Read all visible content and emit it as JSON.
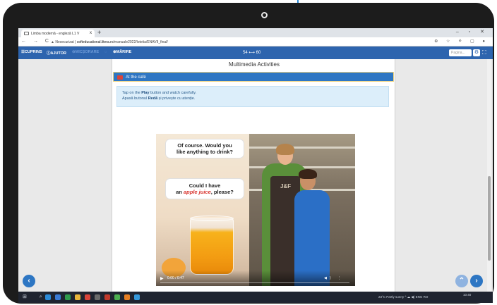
{
  "browser": {
    "tab_title": "Limba modernă - engleză L1 V",
    "new_tab": "+",
    "tab_close": "x",
    "window_controls": "‒ ▫ ✕",
    "nav_buttons": "← → C",
    "security_label": "Nesecurizat",
    "url_domain": "softeducational.litera.ro",
    "url_path": "/manuale2022/lotetia/ENAVII_final/",
    "extension_icons": "⊕ ☆ ⚘ ▢ ●"
  },
  "toolbar": {
    "cuprins": "CUPRINS",
    "ajutor": "AJUTOR",
    "micsorare": "MICȘORARE",
    "marire": "MĂRIRE",
    "pages": "54 ⟷ 60",
    "page_placeholder": "Pagina..."
  },
  "panel": {
    "title": "Multimedia Activities",
    "section": "At the café",
    "instruction_en_pre": "Tap on the ",
    "instruction_en_bold": "Play",
    "instruction_en_post": " button and watch carefully.",
    "instruction_ro_pre": "Apasă butonul ",
    "instruction_ro_bold": "Redă",
    "instruction_ro_post": " și privește cu atenție."
  },
  "video": {
    "bubble1_line1": "Of course. Would you",
    "bubble1_line2": "like anything to drink?",
    "bubble2_line1": "Could I have",
    "bubble2_pre": "an ",
    "bubble2_red": "apple juice",
    "bubble2_post": ", please?",
    "apron_logo": "J&F",
    "time": "0:00 / 0:47",
    "volume_menu": "◀) ⋮"
  },
  "nav": {
    "prev": "‹",
    "top": "⌃",
    "next": "›"
  },
  "taskbar": {
    "status": "23°C Partly sunny  ^  ☁  ◀)  ENG  RO",
    "time": "10:40",
    "date": ""
  },
  "colors": {
    "toolbar_blue": "#2d64ae",
    "section_blue": "#2d76c3",
    "instruction_bg": "#dceefa",
    "accent_red": "#d8312b"
  }
}
